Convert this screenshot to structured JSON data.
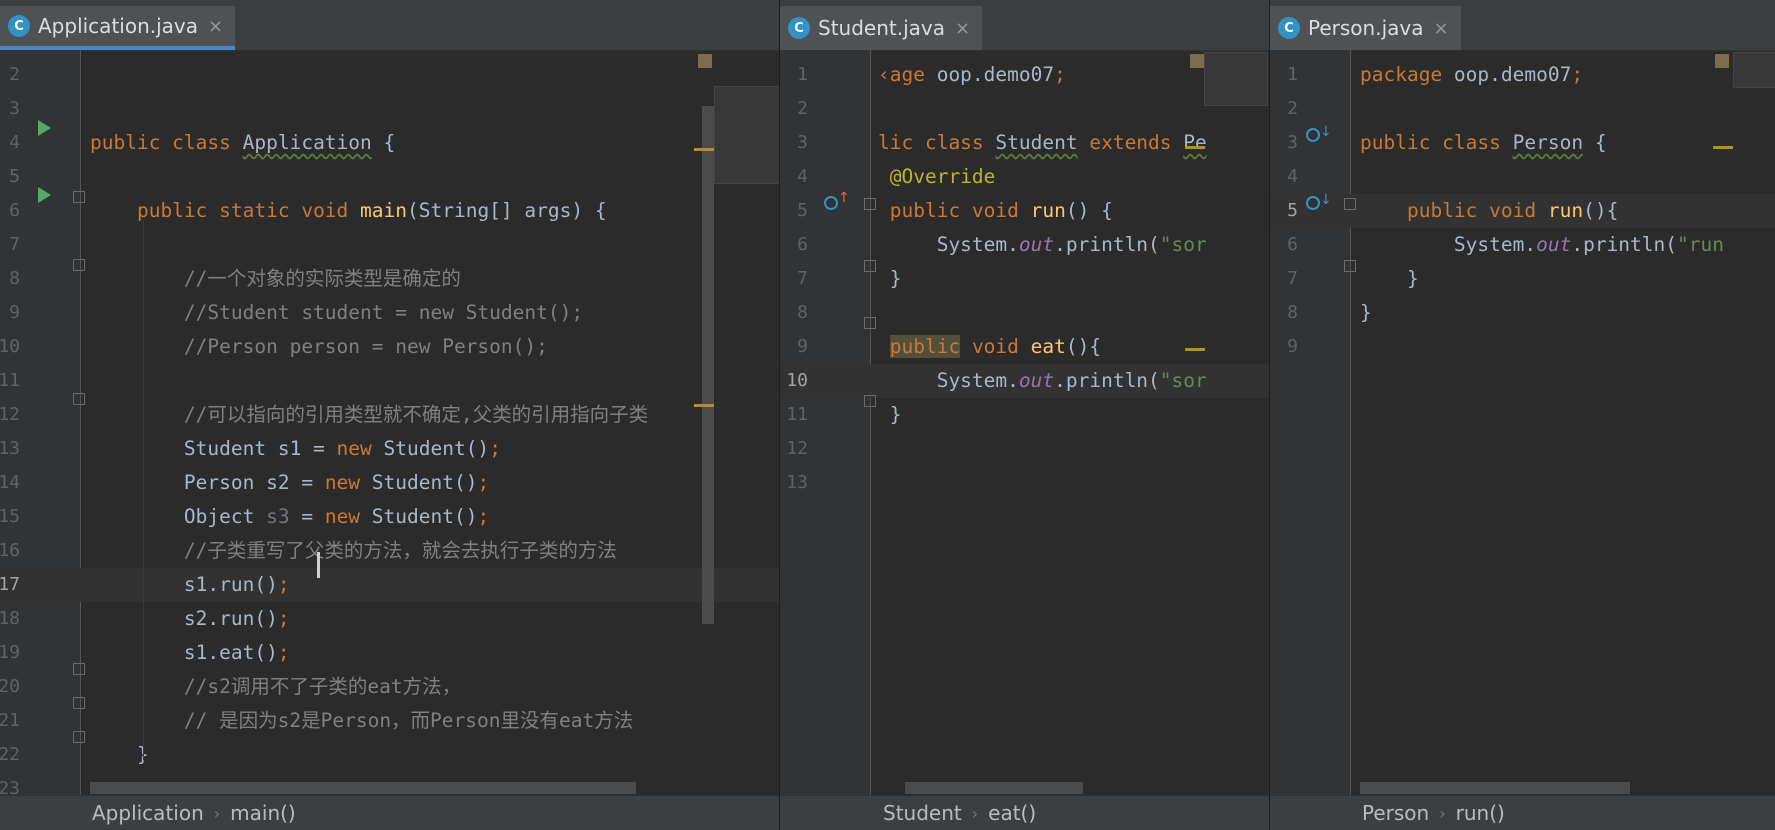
{
  "panes": [
    {
      "tab": {
        "title": "Application.java",
        "icon": "class-icon",
        "close": "×"
      },
      "breadcrumb": [
        "Application",
        "main()"
      ],
      "lines": [
        {
          "n": "2",
          "html": ""
        },
        {
          "n": "3",
          "html": ""
        },
        {
          "n": "4",
          "html": "<span class=\"kw\">public class </span><span class=\"cls\">Application</span> {"
        },
        {
          "n": "5",
          "html": ""
        },
        {
          "n": "6",
          "html": "    <span class=\"kw\">public static void </span><span class=\"fn\">main</span>(String[] args) {"
        },
        {
          "n": "7",
          "html": ""
        },
        {
          "n": "8",
          "html": "        <span class=\"cm\">//一个对象的实际类型是确定的</span>"
        },
        {
          "n": "9",
          "html": "        <span class=\"cm\">//Student student = new Student();</span>"
        },
        {
          "n": "10",
          "html": "        <span class=\"cm\">//Person person = new Person();</span>"
        },
        {
          "n": "11",
          "html": ""
        },
        {
          "n": "12",
          "html": "        <span class=\"cm\">//可以指向的引用类型就不确定,父类的引用指向子类</span>"
        },
        {
          "n": "13",
          "html": "        Student s1 = <span class=\"kw\">new </span>Student()<span class=\"kw\">;</span>"
        },
        {
          "n": "14",
          "html": "        Person s2 = <span class=\"kw\">new </span>Student()<span class=\"kw\">;</span>"
        },
        {
          "n": "15",
          "html": "        Object <span class=\"gray\">s3</span> = <span class=\"kw\">new </span>Student()<span class=\"kw\">;</span>"
        },
        {
          "n": "16",
          "html": "        <span class=\"cm\">//子类重写了父类的方法，就会去执行子类的方法</span>"
        },
        {
          "n": "17",
          "html": "        s1.run()<span class=\"kw\">;</span>",
          "cur": true
        },
        {
          "n": "18",
          "html": "        s2.run()<span class=\"kw\">;</span>"
        },
        {
          "n": "19",
          "html": "        s1.eat()<span class=\"kw\">;</span>"
        },
        {
          "n": "20",
          "html": "        <span class=\"cm\">//s2调用不了子类的eat方法，</span>"
        },
        {
          "n": "21",
          "html": "        <span class=\"cm\">// 是因为s2是Person，而Person里没有eat方法</span>"
        },
        {
          "n": "22",
          "html": "    }"
        },
        {
          "n": "23",
          "html": ""
        }
      ]
    },
    {
      "tab": {
        "title": "Student.java",
        "icon": "class-icon",
        "close": "×"
      },
      "breadcrumb": [
        "Student",
        "eat()"
      ],
      "lines": [
        {
          "n": "1",
          "html": "<span class=\"kw\">‹age </span>oop.demo07<span class=\"kw\">;</span>"
        },
        {
          "n": "2",
          "html": ""
        },
        {
          "n": "3",
          "html": "<span class=\"kw\">lic class </span><span class=\"cls\">Student</span> <span class=\"kw\">extends </span><span class=\"cls\">Pe</span>"
        },
        {
          "n": "4",
          "html": " <span class=\"ann\">@Override</span>"
        },
        {
          "n": "5",
          "html": " <span class=\"kw\">public void </span><span class=\"fn\">run</span>() {"
        },
        {
          "n": "6",
          "html": "     System.<span class=\"it\">out</span>.println(<span class=\"st\">\"sor</span>"
        },
        {
          "n": "7",
          "html": " }"
        },
        {
          "n": "8",
          "html": ""
        },
        {
          "n": "9",
          "html": " <span class=\"kw\" style=\"background:#52503a\">public</span><span class=\"kw\"> void </span><span class=\"fn\">eat</span>(){"
        },
        {
          "n": "10",
          "html": "     System.<span class=\"it\">out</span>.println(<span class=\"st\">\"sor</span>",
          "cur": true
        },
        {
          "n": "11",
          "html": " }"
        },
        {
          "n": "12",
          "html": ""
        },
        {
          "n": "13",
          "html": ""
        }
      ]
    },
    {
      "tab": {
        "title": "Person.java",
        "icon": "class-icon",
        "close": "×"
      },
      "breadcrumb": [
        "Person",
        "run()"
      ],
      "lines": [
        {
          "n": "1",
          "html": "<span class=\"kw\">package </span>oop.demo07<span class=\"kw\">;</span>"
        },
        {
          "n": "2",
          "html": ""
        },
        {
          "n": "3",
          "html": "<span class=\"kw\">public class </span><span class=\"cls\">Person</span> {"
        },
        {
          "n": "4",
          "html": ""
        },
        {
          "n": "5",
          "html": "    <span class=\"kw\">public void </span><span class=\"fn\">run</span>(){",
          "cur": true
        },
        {
          "n": "6",
          "html": "        System.<span class=\"it\">out</span>.println(<span class=\"st\">\"run</span>"
        },
        {
          "n": "7",
          "html": "    }"
        },
        {
          "n": "8",
          "html": "}"
        },
        {
          "n": "9",
          "html": ""
        }
      ]
    }
  ]
}
